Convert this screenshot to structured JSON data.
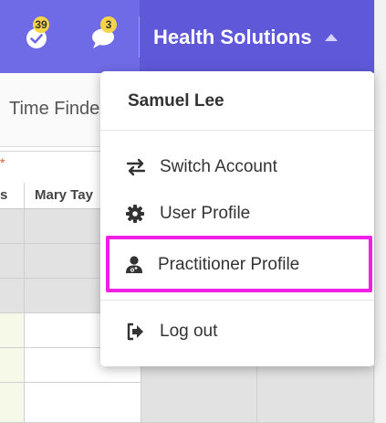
{
  "header": {
    "tasks_badge": "39",
    "messages_badge": "3",
    "org_name": "Health Solutions"
  },
  "page": {
    "tab_label": "Time Finde",
    "asterisk": "*",
    "columns": [
      "s",
      "Mary Tay"
    ]
  },
  "dropdown": {
    "user_name": "Samuel Lee",
    "items": [
      {
        "label": "Switch Account",
        "icon": "switch-arrows-icon"
      },
      {
        "label": "User Profile",
        "icon": "gear-icon"
      },
      {
        "label": "Practitioner Profile",
        "icon": "practitioner-icon"
      },
      {
        "label": "Log out",
        "icon": "logout-icon"
      }
    ]
  },
  "colors": {
    "header": "#6f6ae6",
    "header_active": "#5f59da",
    "badge": "#f5d547",
    "highlight": "#ef1fe8"
  }
}
